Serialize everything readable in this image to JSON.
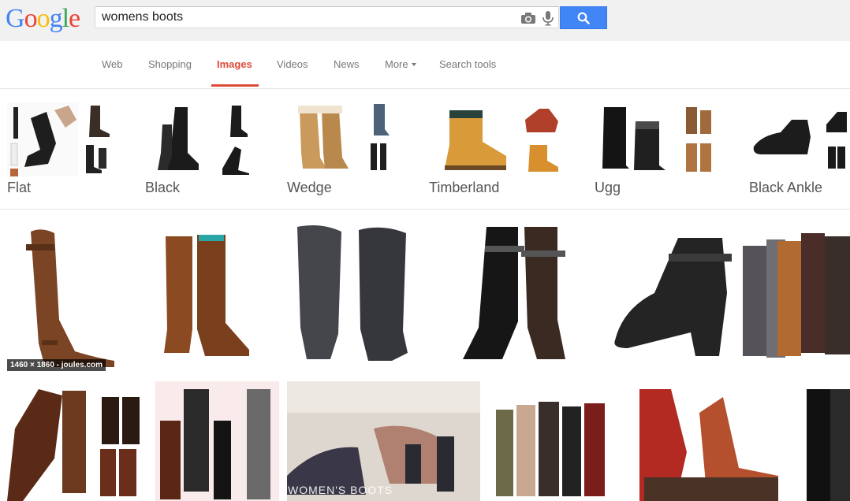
{
  "header": {
    "logo_letters": [
      "G",
      "o",
      "o",
      "g",
      "l",
      "e"
    ],
    "search_value": "womens boots",
    "accent": "#4285f4"
  },
  "nav": {
    "tabs": [
      {
        "label": "Web"
      },
      {
        "label": "Shopping"
      },
      {
        "label": "Images",
        "active": true
      },
      {
        "label": "Videos"
      },
      {
        "label": "News"
      },
      {
        "label": "More"
      },
      {
        "label": "Search tools"
      }
    ],
    "active_color": "#dd4b39"
  },
  "related": [
    {
      "label": "Flat"
    },
    {
      "label": "Black"
    },
    {
      "label": "Wedge"
    },
    {
      "label": "Timberland"
    },
    {
      "label": "Ugg"
    },
    {
      "label": "Black Ankle"
    }
  ],
  "results": {
    "first_caption": "1460 × 1860 - joules.com",
    "overlay_text": "WOMEN'S BOOTS"
  }
}
